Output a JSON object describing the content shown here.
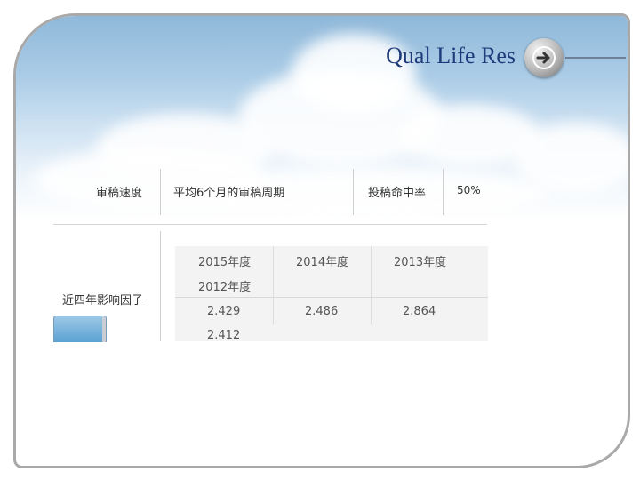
{
  "header": {
    "title": "Qual Life Res",
    "nav_icon": "arrow-right-circle-icon"
  },
  "table": {
    "review_speed_label": "审稿速度",
    "review_period_label": "平均6个月的审稿周期",
    "acceptance_label": "投稿命中率",
    "acceptance_value": "50%",
    "impact_label": "近四年影响因子",
    "years": [
      "2015年度",
      "2014年度",
      "2013年度",
      "2012年度"
    ],
    "factors": [
      "2.429",
      "2.486",
      "2.864",
      "2.412"
    ]
  },
  "colors": {
    "title": "#1f3a7a",
    "frame_border": "#a9a9a9",
    "sky_top": "#8fb8d9",
    "table_bg": "#f3f3f3"
  }
}
